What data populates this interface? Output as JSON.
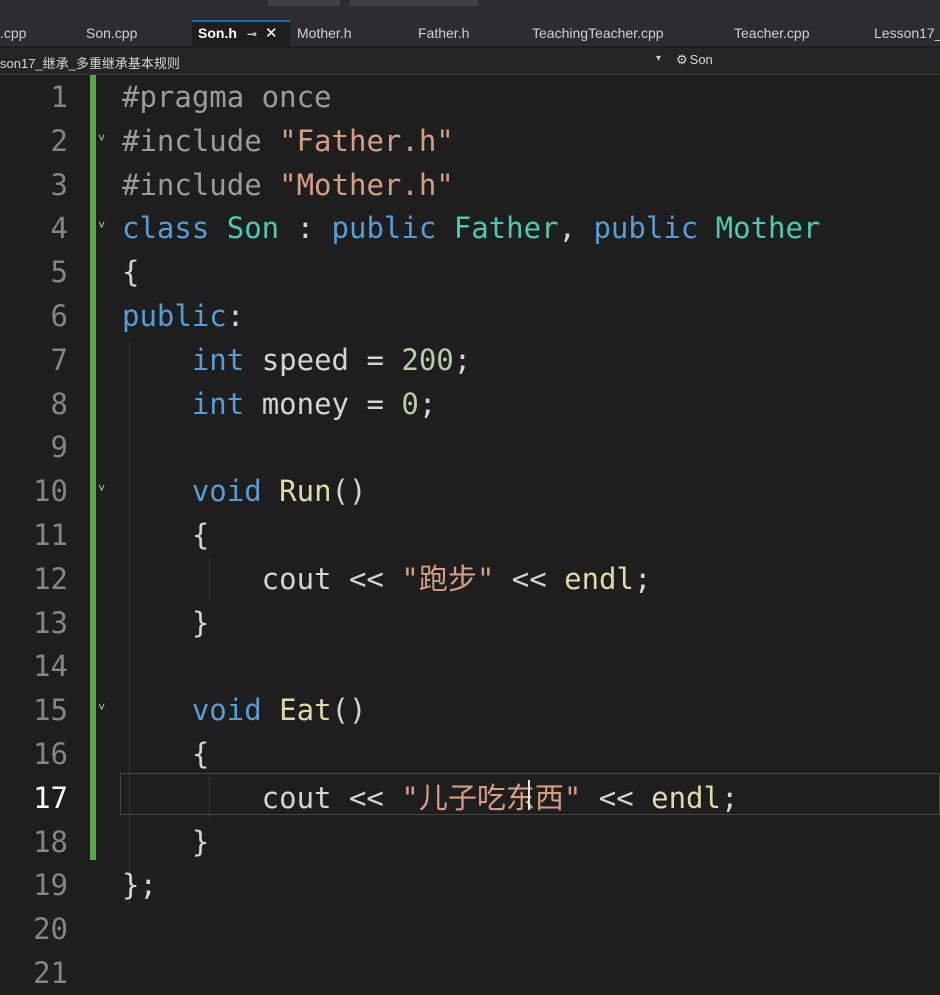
{
  "tabs": [
    {
      "label": ".cpp",
      "active": false
    },
    {
      "label": "Son.cpp",
      "active": false
    },
    {
      "label": "Son.h",
      "active": true,
      "pin": "⊸",
      "close": "✕"
    },
    {
      "label": "Mother.h",
      "active": false
    },
    {
      "label": "Father.h",
      "active": false
    },
    {
      "label": "TeachingTeacher.cpp",
      "active": false
    },
    {
      "label": "Teacher.cpp",
      "active": false
    },
    {
      "label": "Lesson17_",
      "active": false
    }
  ],
  "navbar": {
    "project": "son17_继承_多重继承基本规则",
    "dropdown_arrow": "▾",
    "class_icon": "⚙",
    "class_name": "Son"
  },
  "editor": {
    "current_line": 17,
    "lines": [
      {
        "n": "1",
        "tokens": [
          {
            "t": "#pragma once",
            "c": "pp"
          }
        ]
      },
      {
        "n": "2",
        "fold": "˅",
        "tokens": [
          {
            "t": "#include ",
            "c": "pp"
          },
          {
            "t": "\"Father.h\"",
            "c": "st"
          }
        ]
      },
      {
        "n": "3",
        "tokens": [
          {
            "t": "#include ",
            "c": "pp"
          },
          {
            "t": "\"Mother.h\"",
            "c": "st"
          }
        ]
      },
      {
        "n": "4",
        "fold": "˅",
        "tokens": [
          {
            "t": "class ",
            "c": "kw"
          },
          {
            "t": "Son",
            "c": "ty"
          },
          {
            "t": " : "
          },
          {
            "t": "public ",
            "c": "kw"
          },
          {
            "t": "Father",
            "c": "ty"
          },
          {
            "t": ", "
          },
          {
            "t": "public ",
            "c": "kw"
          },
          {
            "t": "Mother",
            "c": "ty"
          }
        ]
      },
      {
        "n": "5",
        "tokens": [
          {
            "t": "{"
          }
        ]
      },
      {
        "n": "6",
        "tokens": [
          {
            "t": "public",
            "c": "kw"
          },
          {
            "t": ":"
          }
        ]
      },
      {
        "n": "7",
        "tokens": [
          {
            "t": "    "
          },
          {
            "t": "int",
            "c": "kw"
          },
          {
            "t": " speed = "
          },
          {
            "t": "200",
            "c": "nu"
          },
          {
            "t": ";"
          }
        ]
      },
      {
        "n": "8",
        "tokens": [
          {
            "t": "    "
          },
          {
            "t": "int",
            "c": "kw"
          },
          {
            "t": " money = "
          },
          {
            "t": "0",
            "c": "nu"
          },
          {
            "t": ";"
          }
        ]
      },
      {
        "n": "9",
        "tokens": []
      },
      {
        "n": "10",
        "fold": "˅",
        "tokens": [
          {
            "t": "    "
          },
          {
            "t": "void",
            "c": "kw"
          },
          {
            "t": " "
          },
          {
            "t": "Run",
            "c": "fn"
          },
          {
            "t": "()"
          }
        ]
      },
      {
        "n": "11",
        "tokens": [
          {
            "t": "    {"
          }
        ]
      },
      {
        "n": "12",
        "tokens": [
          {
            "t": "        cout << "
          },
          {
            "t": "\"跑步\"",
            "c": "st"
          },
          {
            "t": " << "
          },
          {
            "t": "endl",
            "c": "fn"
          },
          {
            "t": ";"
          }
        ]
      },
      {
        "n": "13",
        "tokens": [
          {
            "t": "    }"
          }
        ]
      },
      {
        "n": "14",
        "tokens": []
      },
      {
        "n": "15",
        "fold": "˅",
        "tokens": [
          {
            "t": "    "
          },
          {
            "t": "void",
            "c": "kw"
          },
          {
            "t": " "
          },
          {
            "t": "Eat",
            "c": "fn"
          },
          {
            "t": "()"
          }
        ]
      },
      {
        "n": "16",
        "tokens": [
          {
            "t": "    {"
          }
        ]
      },
      {
        "n": "17",
        "tokens": [
          {
            "t": "        cout << "
          },
          {
            "t": "\"儿子吃东西\"",
            "c": "st"
          },
          {
            "t": " << "
          },
          {
            "t": "endl",
            "c": "fn"
          },
          {
            "t": ";"
          }
        ]
      },
      {
        "n": "18",
        "tokens": [
          {
            "t": "    }"
          }
        ]
      },
      {
        "n": "19",
        "tokens": [
          {
            "t": "};"
          }
        ]
      },
      {
        "n": "20",
        "tokens": []
      },
      {
        "n": "21",
        "tokens": []
      }
    ]
  }
}
